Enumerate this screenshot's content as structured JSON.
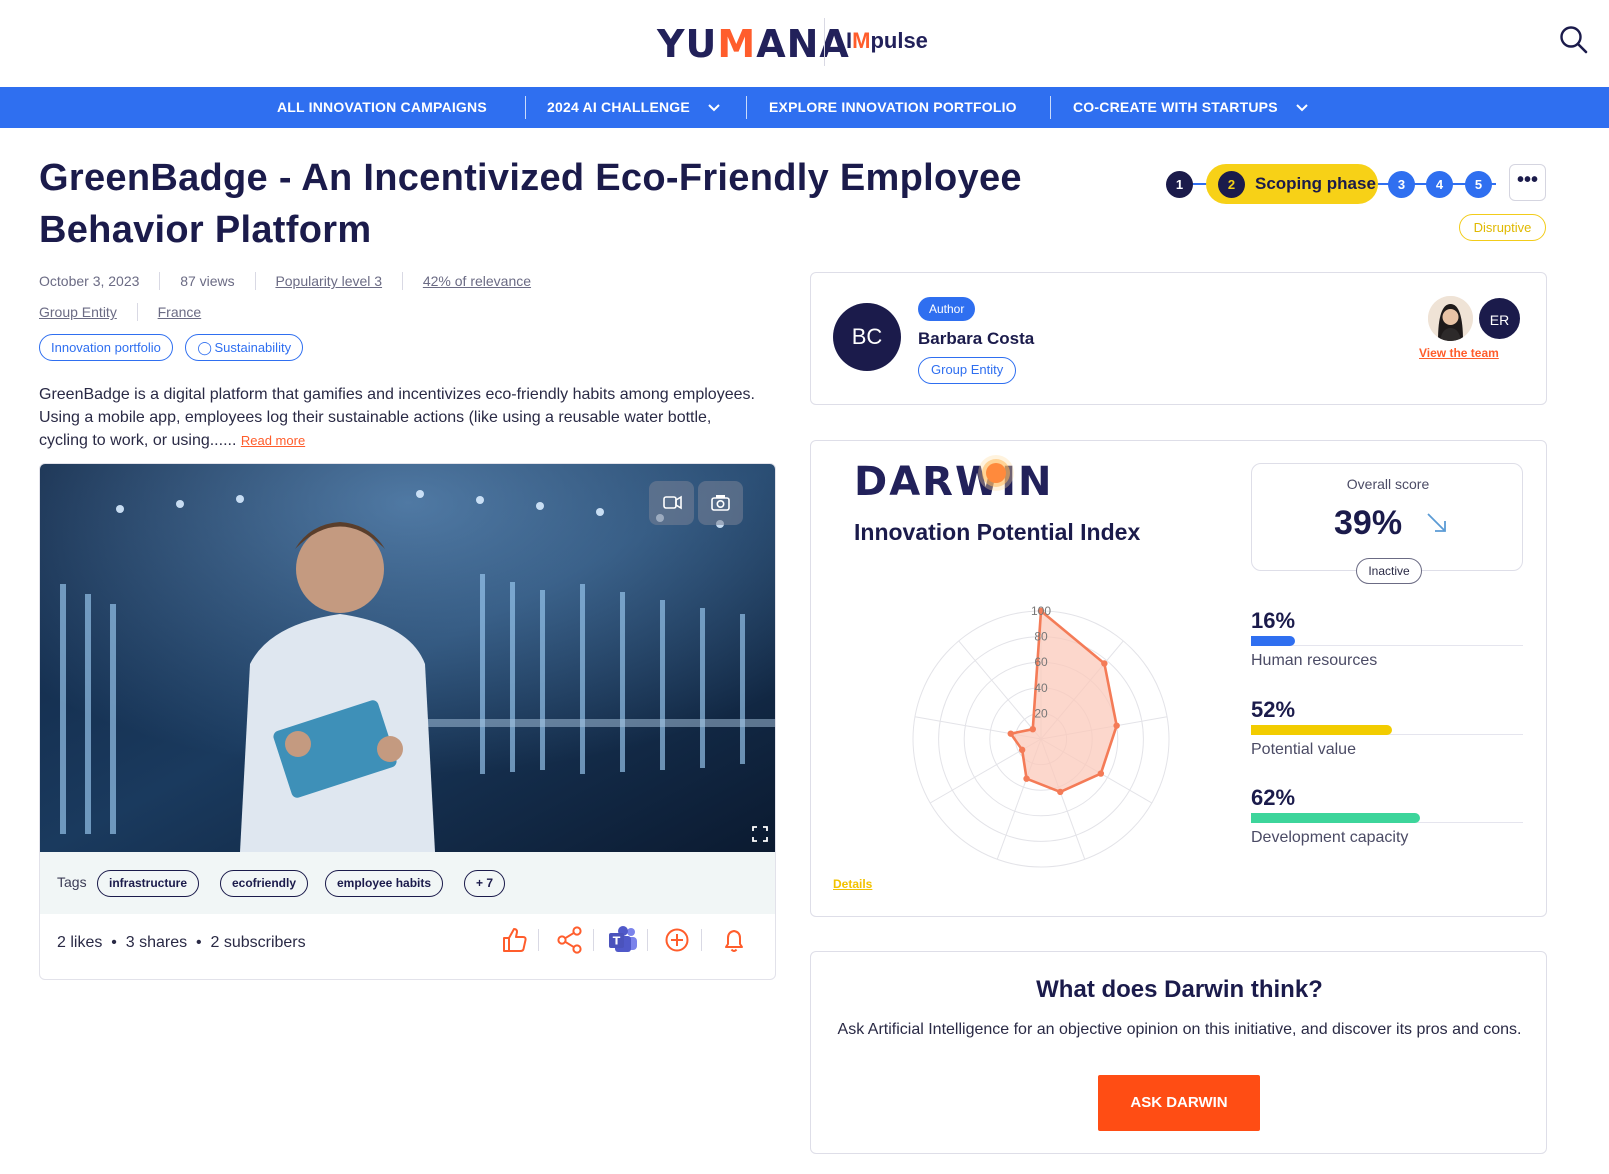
{
  "header": {
    "logo_text": "YUMANA",
    "product_text": "Impulse",
    "search_icon": "search-icon"
  },
  "nav": {
    "items": [
      {
        "label": "ALL INNOVATION CAMPAIGNS",
        "has_dropdown": false
      },
      {
        "label": "2024 AI CHALLENGE",
        "has_dropdown": true
      },
      {
        "label": "EXPLORE INNOVATION PORTFOLIO",
        "has_dropdown": false
      },
      {
        "label": "CO-CREATE WITH STARTUPS",
        "has_dropdown": true
      }
    ],
    "background": "#2f6ff0"
  },
  "idea": {
    "title": "GreenBadge - An Incentivized Eco-Friendly Employee Behavior Platform",
    "date": "October 3, 2023",
    "views": "87 views",
    "popularity": "Popularity level 3",
    "relevance": "42% of relevance",
    "entity": "Group Entity",
    "country": "France",
    "chips": [
      "Innovation portfolio",
      "Sustainability"
    ],
    "description": "GreenBadge is a digital platform that gamifies and incentivizes eco-friendly habits among employees. Using a mobile app, employees log their sustainable actions (like using a reusable water bottle, cycling to work, or using......",
    "read_more": "Read more",
    "category_badge": "Disruptive"
  },
  "phases": {
    "steps": [
      "1",
      "2",
      "3",
      "4",
      "5"
    ],
    "active_step": "2",
    "active_label": "Scoping phase",
    "more_label": "•••"
  },
  "media": {
    "tags_label": "Tags",
    "tags": [
      "infrastructure",
      "ecofriendly",
      "employee habits",
      "+ 7"
    ],
    "social_text": "2 likes  •  3 shares  •  2 subscribers",
    "actions": [
      "like-icon",
      "share-icon",
      "teams-icon",
      "add-icon",
      "bell-icon"
    ]
  },
  "author": {
    "badge": "Author",
    "initials": "BC",
    "name": "Barbara Costa",
    "entity": "Group Entity",
    "team_member_initials": "ER",
    "view_team": "View the team"
  },
  "darwin": {
    "logo_text": "DARWIN",
    "title": "Innovation Potential Index",
    "overall_label": "Overall score",
    "overall_value": "39%",
    "trend": "down",
    "status": "Inactive",
    "details_link": "Details",
    "metrics": [
      {
        "value": "16%",
        "label": "Human resources",
        "fraction": 0.16,
        "color": "#2f6ff0"
      },
      {
        "value": "52%",
        "label": "Potential value",
        "fraction": 0.52,
        "color": "#f2cc00"
      },
      {
        "value": "62%",
        "label": "Development capacity",
        "fraction": 0.62,
        "color": "#3dd59b"
      }
    ]
  },
  "chart_data": {
    "type": "radar",
    "title": "",
    "radial_ticks": [
      "20",
      "40",
      "60",
      "80",
      "100"
    ],
    "range": [
      0,
      100
    ],
    "values": [
      100,
      77,
      60,
      54,
      44,
      33,
      17,
      24,
      10
    ],
    "color": "#f47b57",
    "fill": "#fbcabb"
  },
  "ask": {
    "title": "What does Darwin think?",
    "text": "Ask Artificial Intelligence for an objective opinion on this initiative, and discover its pros and cons.",
    "button": "ASK DARWIN"
  }
}
